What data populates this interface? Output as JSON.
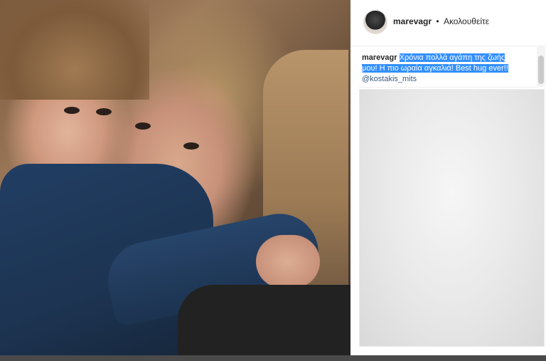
{
  "post": {
    "photo_alt": "Photo of a woman hugging a young child"
  },
  "header": {
    "username": "marevagr",
    "separator": "•",
    "follow_state": "Ακολουθείτε"
  },
  "caption": {
    "username": "marevagr",
    "text_selected": "Χρόνια πολλά αγάπη της ζωής μου! Η πιο ωραία αγκαλιά! Best hug ever!!",
    "mention": "@kostakis_mits"
  },
  "icons": {
    "avatar": "profile-avatar"
  },
  "colors": {
    "selection": "#3390ff",
    "mention": "#3d5a80"
  }
}
